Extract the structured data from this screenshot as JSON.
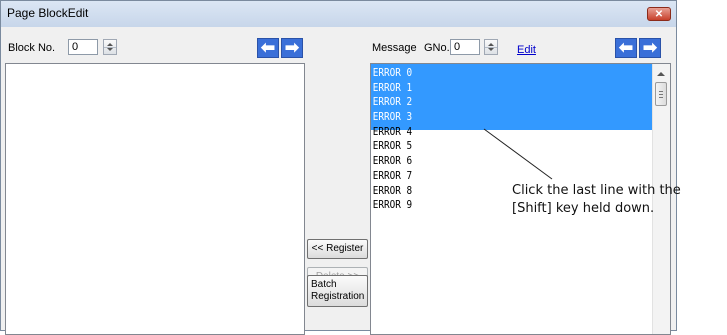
{
  "window": {
    "title": "Page BlockEdit",
    "close_glyph": "✕"
  },
  "left_panel": {
    "block_label": "Block No.",
    "block_value": "0",
    "nav_left_glyph": "⬅",
    "nav_right_glyph": "➡"
  },
  "right_panel": {
    "message_label": "Message",
    "gno_label": "GNo.",
    "gno_value": "0",
    "edit_link": "Edit",
    "nav_left_glyph": "⬅",
    "nav_right_glyph": "➡",
    "messages": [
      "ERROR 0",
      "ERROR 1",
      "ERROR 2",
      "ERROR 3",
      "ERROR 4",
      "ERROR 5",
      "ERROR 6",
      "ERROR 7",
      "ERROR 8",
      "ERROR 9"
    ],
    "selected_indices": [
      0,
      1,
      2,
      3
    ]
  },
  "buttons": {
    "register": "<< Register",
    "delete": "Delete >>",
    "batch_line1": "Batch",
    "batch_line2": "Registration"
  },
  "callout": {
    "line1": "Click the last line with the",
    "line2": "[Shift] key held down."
  },
  "colors": {
    "selection": "#3399ff",
    "arrow_button": "#3a6fd8",
    "link": "#0000cc"
  },
  "icons": [
    "close-icon",
    "left-arrow-icon",
    "right-arrow-icon",
    "spin-up-icon",
    "spin-down-icon",
    "scroll-up-icon"
  ]
}
